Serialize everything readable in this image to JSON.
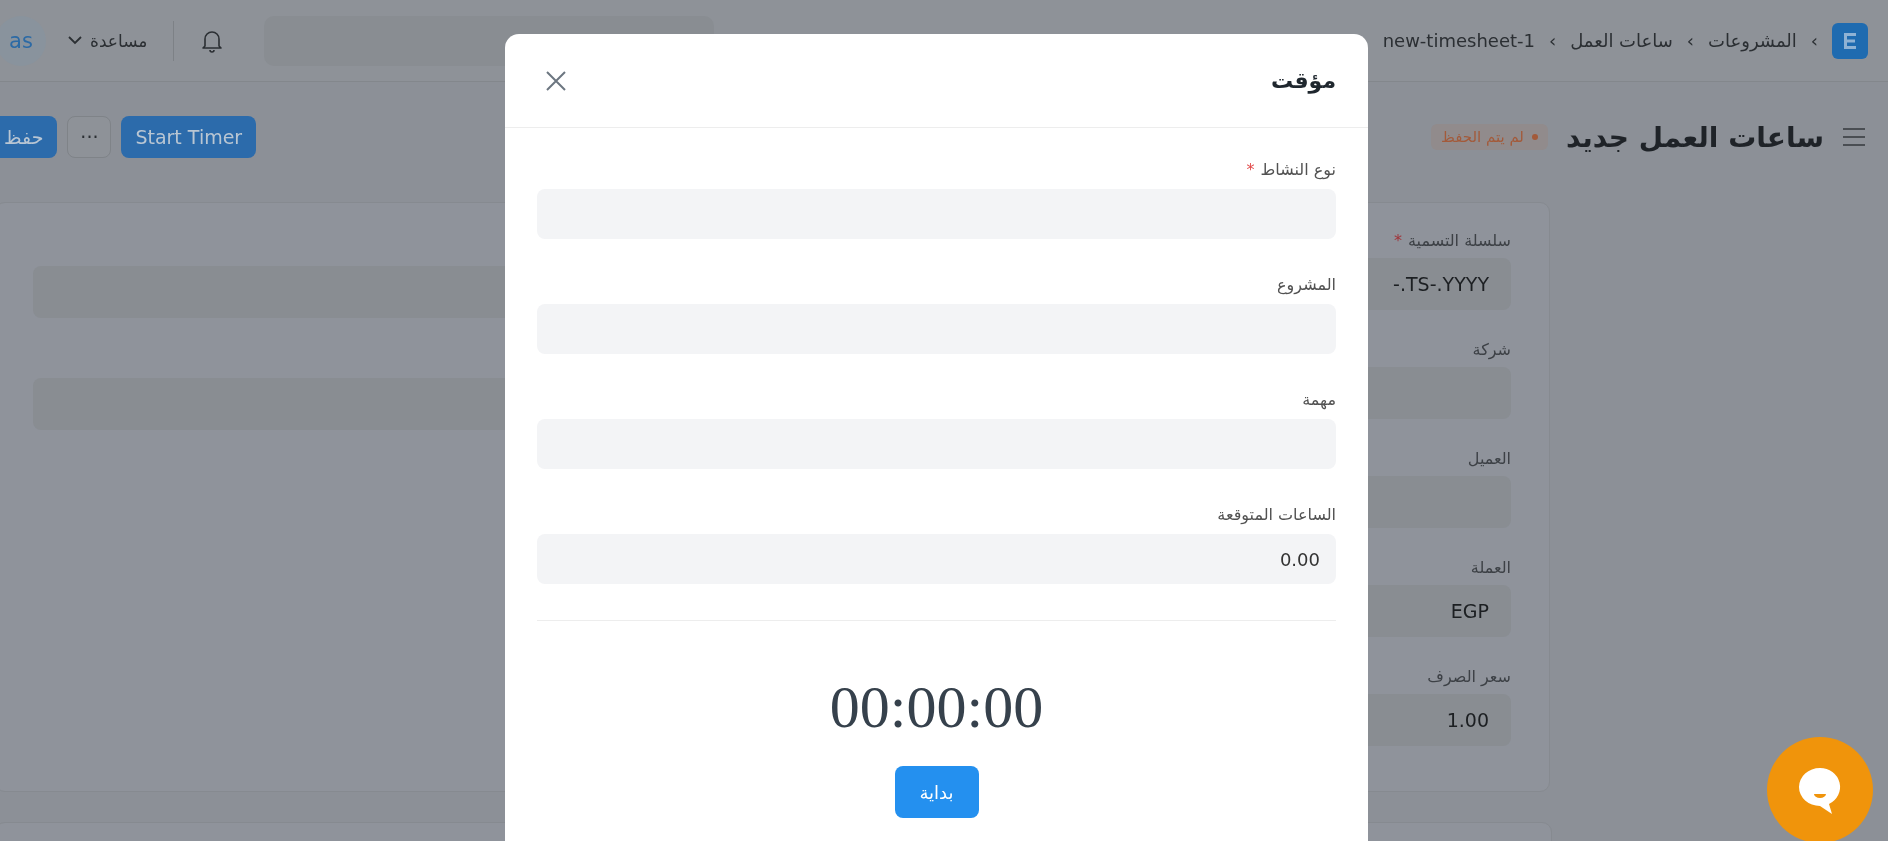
{
  "navbar": {
    "avatar": "as",
    "help_menu": "مساعدة",
    "breadcrumbs": [
      {
        "separator": "›",
        "label": "المشروعات"
      },
      {
        "separator": "›",
        "label": "ساعات العمل"
      },
      {
        "separator": "›",
        "label": "new-timesheet-1"
      }
    ]
  },
  "page_header": {
    "title": "ساعات العمل جديد",
    "status_badge": "لم يتم الحفظ",
    "buttons": [
      {
        "label": "Start Timer",
        "kind": "primary"
      },
      {
        "label": "···",
        "kind": "more"
      },
      {
        "label": "حفظ",
        "kind": "primary"
      }
    ]
  },
  "form": {
    "fields": [
      {
        "label": "سلسلة التسمية",
        "required_mark": "*",
        "value": "-.TS-.YYYY"
      },
      {
        "label": "شركة"
      },
      {
        "label": "العميل"
      },
      {
        "label": "العملة",
        "value": "EGP"
      },
      {
        "label": "سعر الصرف",
        "value": "1.00"
      }
    ]
  },
  "modal": {
    "title": "مؤقت",
    "fields": [
      {
        "label": "نوع النشاط",
        "required_mark": "*"
      },
      {
        "label": "المشروع"
      },
      {
        "label": "مهمة"
      },
      {
        "label": "الساعات المتوقعة",
        "value": "0.00"
      }
    ],
    "timer": "00:00:00",
    "start_button": "بداية"
  }
}
